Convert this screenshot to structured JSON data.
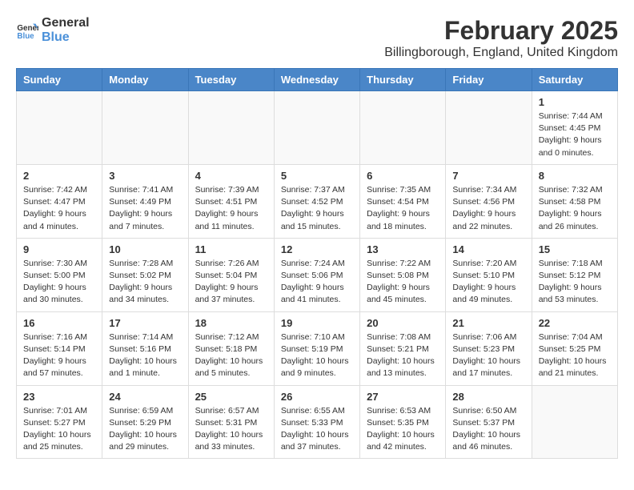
{
  "logo": {
    "line1": "General",
    "line2": "Blue"
  },
  "title": "February 2025",
  "subtitle": "Billingborough, England, United Kingdom",
  "days_of_week": [
    "Sunday",
    "Monday",
    "Tuesday",
    "Wednesday",
    "Thursday",
    "Friday",
    "Saturday"
  ],
  "weeks": [
    [
      {
        "day": "",
        "info": ""
      },
      {
        "day": "",
        "info": ""
      },
      {
        "day": "",
        "info": ""
      },
      {
        "day": "",
        "info": ""
      },
      {
        "day": "",
        "info": ""
      },
      {
        "day": "",
        "info": ""
      },
      {
        "day": "1",
        "info": "Sunrise: 7:44 AM\nSunset: 4:45 PM\nDaylight: 9 hours and 0 minutes."
      }
    ],
    [
      {
        "day": "2",
        "info": "Sunrise: 7:42 AM\nSunset: 4:47 PM\nDaylight: 9 hours and 4 minutes."
      },
      {
        "day": "3",
        "info": "Sunrise: 7:41 AM\nSunset: 4:49 PM\nDaylight: 9 hours and 7 minutes."
      },
      {
        "day": "4",
        "info": "Sunrise: 7:39 AM\nSunset: 4:51 PM\nDaylight: 9 hours and 11 minutes."
      },
      {
        "day": "5",
        "info": "Sunrise: 7:37 AM\nSunset: 4:52 PM\nDaylight: 9 hours and 15 minutes."
      },
      {
        "day": "6",
        "info": "Sunrise: 7:35 AM\nSunset: 4:54 PM\nDaylight: 9 hours and 18 minutes."
      },
      {
        "day": "7",
        "info": "Sunrise: 7:34 AM\nSunset: 4:56 PM\nDaylight: 9 hours and 22 minutes."
      },
      {
        "day": "8",
        "info": "Sunrise: 7:32 AM\nSunset: 4:58 PM\nDaylight: 9 hours and 26 minutes."
      }
    ],
    [
      {
        "day": "9",
        "info": "Sunrise: 7:30 AM\nSunset: 5:00 PM\nDaylight: 9 hours and 30 minutes."
      },
      {
        "day": "10",
        "info": "Sunrise: 7:28 AM\nSunset: 5:02 PM\nDaylight: 9 hours and 34 minutes."
      },
      {
        "day": "11",
        "info": "Sunrise: 7:26 AM\nSunset: 5:04 PM\nDaylight: 9 hours and 37 minutes."
      },
      {
        "day": "12",
        "info": "Sunrise: 7:24 AM\nSunset: 5:06 PM\nDaylight: 9 hours and 41 minutes."
      },
      {
        "day": "13",
        "info": "Sunrise: 7:22 AM\nSunset: 5:08 PM\nDaylight: 9 hours and 45 minutes."
      },
      {
        "day": "14",
        "info": "Sunrise: 7:20 AM\nSunset: 5:10 PM\nDaylight: 9 hours and 49 minutes."
      },
      {
        "day": "15",
        "info": "Sunrise: 7:18 AM\nSunset: 5:12 PM\nDaylight: 9 hours and 53 minutes."
      }
    ],
    [
      {
        "day": "16",
        "info": "Sunrise: 7:16 AM\nSunset: 5:14 PM\nDaylight: 9 hours and 57 minutes."
      },
      {
        "day": "17",
        "info": "Sunrise: 7:14 AM\nSunset: 5:16 PM\nDaylight: 10 hours and 1 minute."
      },
      {
        "day": "18",
        "info": "Sunrise: 7:12 AM\nSunset: 5:18 PM\nDaylight: 10 hours and 5 minutes."
      },
      {
        "day": "19",
        "info": "Sunrise: 7:10 AM\nSunset: 5:19 PM\nDaylight: 10 hours and 9 minutes."
      },
      {
        "day": "20",
        "info": "Sunrise: 7:08 AM\nSunset: 5:21 PM\nDaylight: 10 hours and 13 minutes."
      },
      {
        "day": "21",
        "info": "Sunrise: 7:06 AM\nSunset: 5:23 PM\nDaylight: 10 hours and 17 minutes."
      },
      {
        "day": "22",
        "info": "Sunrise: 7:04 AM\nSunset: 5:25 PM\nDaylight: 10 hours and 21 minutes."
      }
    ],
    [
      {
        "day": "23",
        "info": "Sunrise: 7:01 AM\nSunset: 5:27 PM\nDaylight: 10 hours and 25 minutes."
      },
      {
        "day": "24",
        "info": "Sunrise: 6:59 AM\nSunset: 5:29 PM\nDaylight: 10 hours and 29 minutes."
      },
      {
        "day": "25",
        "info": "Sunrise: 6:57 AM\nSunset: 5:31 PM\nDaylight: 10 hours and 33 minutes."
      },
      {
        "day": "26",
        "info": "Sunrise: 6:55 AM\nSunset: 5:33 PM\nDaylight: 10 hours and 37 minutes."
      },
      {
        "day": "27",
        "info": "Sunrise: 6:53 AM\nSunset: 5:35 PM\nDaylight: 10 hours and 42 minutes."
      },
      {
        "day": "28",
        "info": "Sunrise: 6:50 AM\nSunset: 5:37 PM\nDaylight: 10 hours and 46 minutes."
      },
      {
        "day": "",
        "info": ""
      }
    ]
  ]
}
